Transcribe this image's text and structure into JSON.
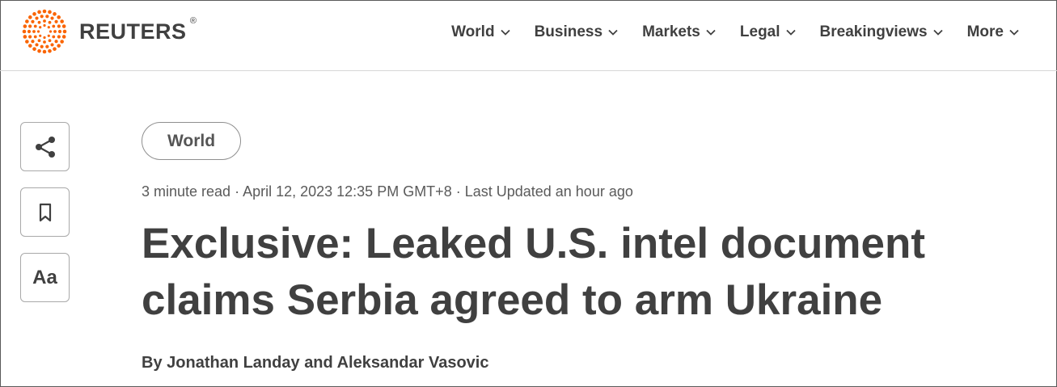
{
  "brand": {
    "name": "REUTERS",
    "registered_mark": "®",
    "logo_icon": "reuters-dot-globe-icon",
    "accent_color": "#fa6400"
  },
  "nav": {
    "items": [
      {
        "label": "World",
        "icon": "chevron-down-icon"
      },
      {
        "label": "Business",
        "icon": "chevron-down-icon"
      },
      {
        "label": "Markets",
        "icon": "chevron-down-icon"
      },
      {
        "label": "Legal",
        "icon": "chevron-down-icon"
      },
      {
        "label": "Breakingviews",
        "icon": "chevron-down-icon"
      },
      {
        "label": "More",
        "icon": "chevron-down-icon"
      }
    ]
  },
  "toolbar": {
    "share_icon": "share-icon",
    "bookmark_icon": "bookmark-icon",
    "text_size_label": "Aa"
  },
  "article": {
    "category": "World",
    "meta": "3 minute read · April 12, 2023 12:35 PM GMT+8 · Last Updated an hour ago",
    "headline": "Exclusive: Leaked U.S. intel document claims Serbia agreed to arm Ukraine",
    "byline": {
      "prefix": "By",
      "author_1": "Jonathan Landay",
      "conjunction": "and",
      "author_2": "Aleksandar Vasovic"
    }
  },
  "colors": {
    "text": "#404040",
    "border": "#a9a9a9"
  }
}
